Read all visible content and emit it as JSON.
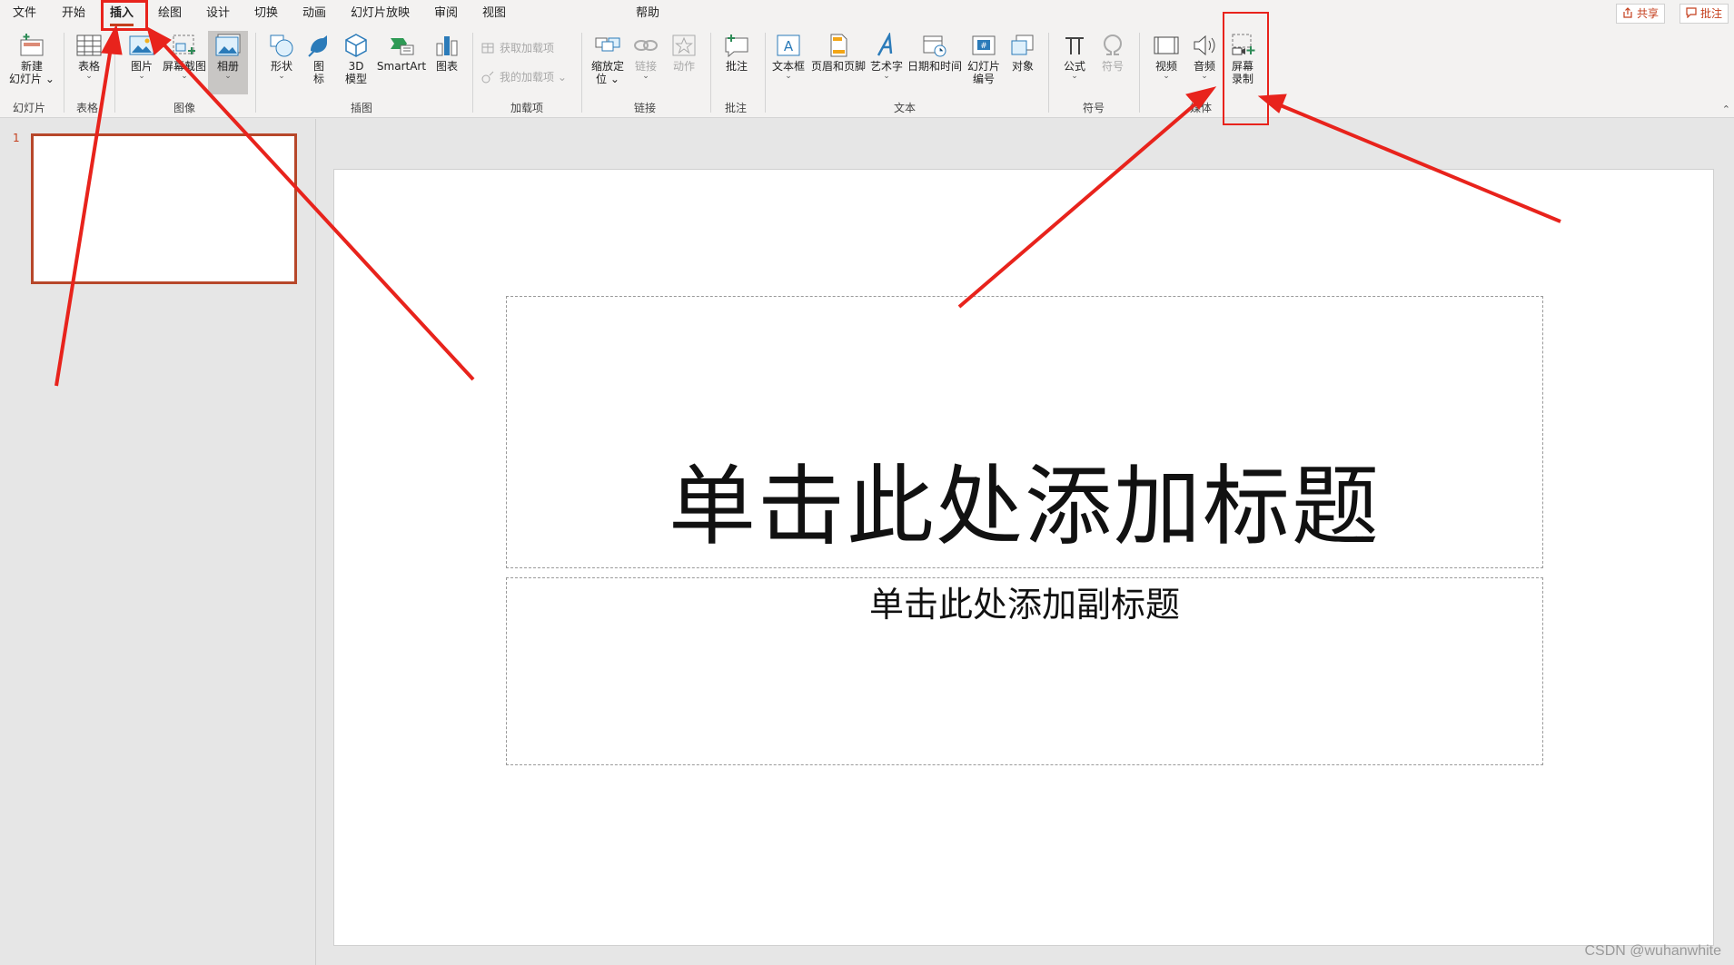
{
  "tabs": [
    "文件",
    "开始",
    "插入",
    "绘图",
    "设计",
    "切换",
    "动画",
    "幻灯片放映",
    "审阅",
    "视图",
    "帮助"
  ],
  "top_buttons": {
    "share": "共享",
    "comments": "批注"
  },
  "ribbon": {
    "new_slide": [
      "新建",
      "幻灯片"
    ],
    "table": "表格",
    "picture": "图片",
    "screenshot": "屏幕截图",
    "album": "相册",
    "shapes": "形状",
    "icons": [
      "图",
      "标"
    ],
    "model3d": [
      "3D",
      "模型"
    ],
    "smartart": "SmartArt",
    "chart": "图表",
    "get_addins": "获取加载项",
    "my_addins": "我的加载项",
    "zoom": [
      "缩放定",
      "位"
    ],
    "link": "链接",
    "action": "动作",
    "comment": "批注",
    "textbox": "文本框",
    "header_footer": "页眉和页脚",
    "wordart": "艺术字",
    "datetime": "日期和时间",
    "slide_number": [
      "幻灯片",
      "编号"
    ],
    "object": "对象",
    "equation": "公式",
    "symbol": "符号",
    "video": "视频",
    "audio": "音频",
    "screen_record": [
      "屏幕",
      "录制"
    ],
    "groups": {
      "slides": "幻灯片",
      "tables": "表格",
      "images": "图像",
      "illustrations": "插图",
      "addins": "加载项",
      "links": "链接",
      "comments": "批注",
      "text": "文本",
      "symbols": "符号",
      "media": "媒体"
    }
  },
  "thumbnail_number": "1",
  "slide": {
    "title_placeholder": "单击此处添加标题",
    "subtitle_placeholder": "单击此处添加副标题"
  },
  "watermark": "CSDN @wuhanwhite",
  "colors": {
    "accent": "#c43e1c",
    "annotation": "#e8231c",
    "thumb_border": "#b7472a"
  }
}
